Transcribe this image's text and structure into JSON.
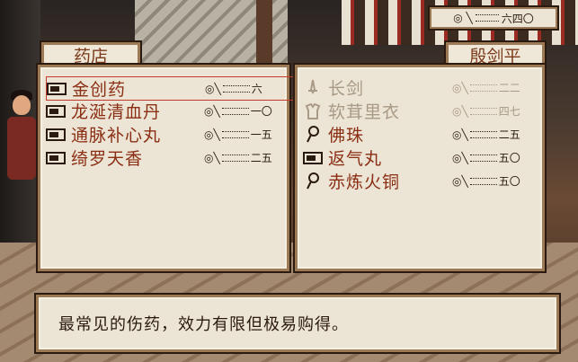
{
  "shop": {
    "title": "药店",
    "items": [
      {
        "name": "金创药",
        "stat": "六",
        "selected": true
      },
      {
        "name": "龙涎清血丹",
        "stat": "一〇"
      },
      {
        "name": "通脉补心丸",
        "stat": "一五"
      },
      {
        "name": "绮罗天香",
        "stat": "二五"
      }
    ]
  },
  "character": {
    "name": "殷剑平",
    "items": [
      {
        "name": "长剑",
        "stat": "二二",
        "dim": true
      },
      {
        "name": "软茸里衣",
        "stat": "四七",
        "dim": true
      },
      {
        "name": "佛珠",
        "stat": "二五",
        "dim": false
      },
      {
        "name": "返气丸",
        "stat": "五〇",
        "dim": false
      },
      {
        "name": "赤炼火铜",
        "stat": "五〇",
        "dim": false
      }
    ]
  },
  "money": {
    "value": "六四〇"
  },
  "description": "最常见的伤药，效力有限但极易购得。",
  "icons": {
    "item": "scroll-icon",
    "weapon": "sword-icon",
    "armor": "robe-icon",
    "accessory": "bead-icon",
    "coin": "coin-icon"
  }
}
